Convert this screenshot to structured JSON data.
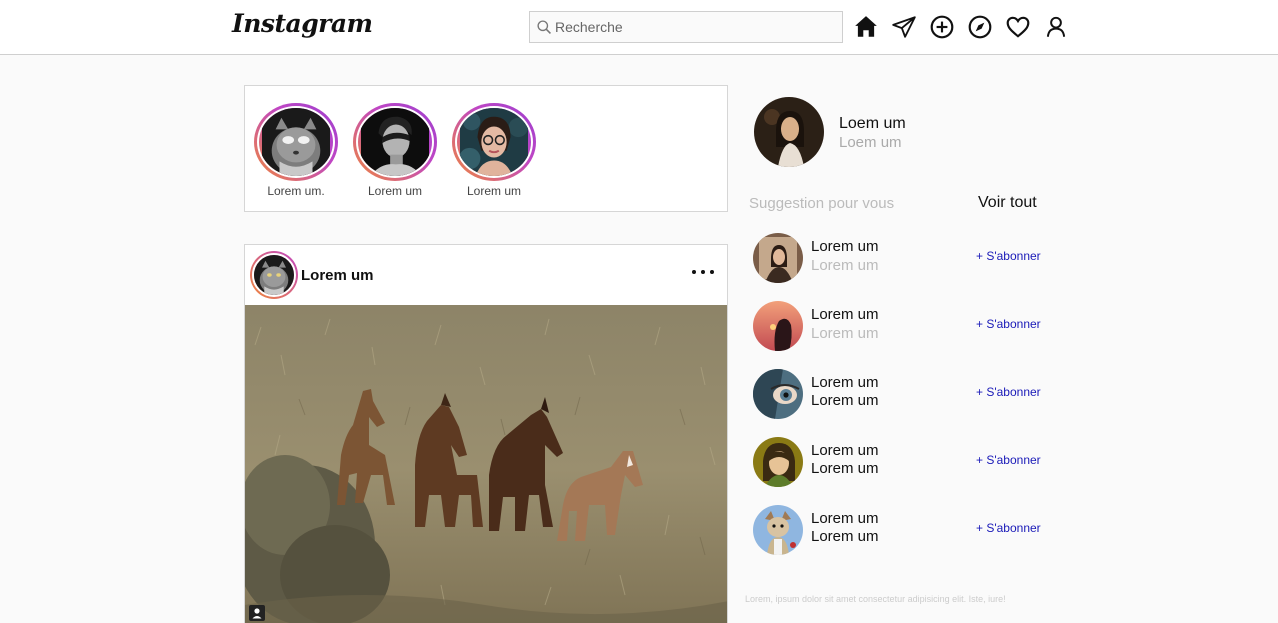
{
  "header": {
    "logo": "Instagram",
    "search_placeholder": "Recherche",
    "icons": [
      "home-icon",
      "send-icon",
      "add-post-icon",
      "explore-icon",
      "heart-icon",
      "profile-icon"
    ]
  },
  "stories": [
    {
      "label": "Lorem um."
    },
    {
      "label": "Lorem um"
    },
    {
      "label": "Lorem um"
    }
  ],
  "post": {
    "username": "Lorem um"
  },
  "profile": {
    "name": "Loem um",
    "subtitle": "Loem um"
  },
  "suggestions": {
    "title": "Suggestion pour vous",
    "see_all": "Voir tout",
    "items": [
      {
        "name": "Lorem um",
        "subtitle": "Lorem um",
        "follow": "+ S'abonner"
      },
      {
        "name": "Lorem um",
        "subtitle": "Lorem um",
        "follow": "+ S'abonner"
      },
      {
        "name": "Lorem um",
        "subtitle": "Lorem um",
        "follow": "+ S'abonner"
      },
      {
        "name": "Lorem um",
        "subtitle": "Lorem um",
        "follow": "+ S'abonner"
      },
      {
        "name": "Lorem um",
        "subtitle": "Lorem um",
        "follow": "+ S'abonner"
      }
    ]
  },
  "footer": "Lorem, ipsum dolor sit amet consectetur adipisicing elit. Iste, iure!",
  "colors": {
    "story_ring_start": "#f0883a",
    "story_ring_end": "#c046c4",
    "follow_link": "#1a1ab8"
  }
}
